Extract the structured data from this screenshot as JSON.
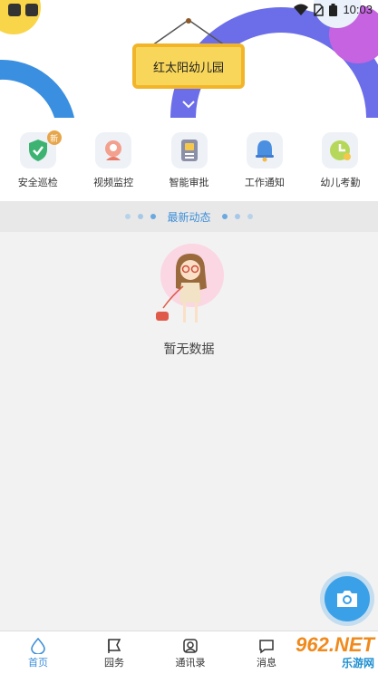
{
  "status_bar": {
    "time": "10:03",
    "icons": [
      "wifi-icon",
      "no-sim-icon",
      "battery-icon"
    ]
  },
  "school": {
    "name": "红太阳幼儿园"
  },
  "nav": {
    "items": [
      {
        "label": "安全巡检",
        "icon": "shield-check-icon",
        "badge": "新"
      },
      {
        "label": "视频监控",
        "icon": "camera-person-icon"
      },
      {
        "label": "智能审批",
        "icon": "approval-doc-icon"
      },
      {
        "label": "工作通知",
        "icon": "bell-icon"
      },
      {
        "label": "幼儿考勤",
        "icon": "clock-icon"
      }
    ]
  },
  "news": {
    "title": "最新动态"
  },
  "empty": {
    "text": "暂无数据"
  },
  "fab": {
    "icon": "camera-icon"
  },
  "tabbar": {
    "tabs": [
      {
        "label": "首页",
        "icon": "home-drop-icon",
        "active": true
      },
      {
        "label": "园务",
        "icon": "flag-icon"
      },
      {
        "label": "通讯录",
        "icon": "contacts-icon"
      },
      {
        "label": "消息",
        "icon": "message-icon"
      }
    ]
  },
  "watermark": {
    "line1": "962.NET",
    "line2": "乐游网"
  },
  "colors": {
    "accent": "#3d8fd8",
    "sign_yellow": "#f8d65a",
    "sign_border": "#f2b52a",
    "arc_purple": "#6b6ee8",
    "arc_blue": "#3a8fe0"
  }
}
